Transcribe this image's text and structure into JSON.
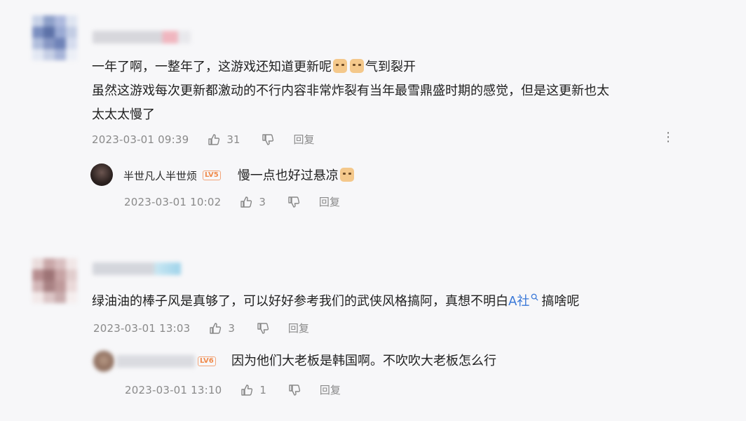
{
  "comments": [
    {
      "line1_a": "一年了啊，一整年了，这游戏还知道更新呢",
      "line1_b": "气到裂开",
      "line2": "虽然这游戏每次更新都激动的不行内容非常炸裂有当年最雪鼎盛时期的感觉，但是这更新也太",
      "line3": "太太太慢了",
      "time": "2023-03-01 09:39",
      "likes": "31",
      "reply_label": "回复",
      "more": "⋮",
      "reply": {
        "user": "半世凡人半世烦",
        "level": "LV5",
        "text": "慢一点也好过悬凉",
        "time": "2023-03-01 10:02",
        "likes": "3",
        "reply_label": "回复"
      }
    },
    {
      "text_a": "绿油油的棒子风是真够了，可以好好参考我们的武侠风格搞阿，真想不明白",
      "link": "A社",
      "text_b": "搞啥呢",
      "time": "2023-03-01 13:03",
      "likes": "3",
      "reply_label": "回复",
      "reply": {
        "level": "LV6",
        "text": "因为他们大老板是韩国啊。不吹吹大老板怎么行",
        "time": "2023-03-01 13:10",
        "likes": "1",
        "reply_label": "回复"
      }
    }
  ]
}
